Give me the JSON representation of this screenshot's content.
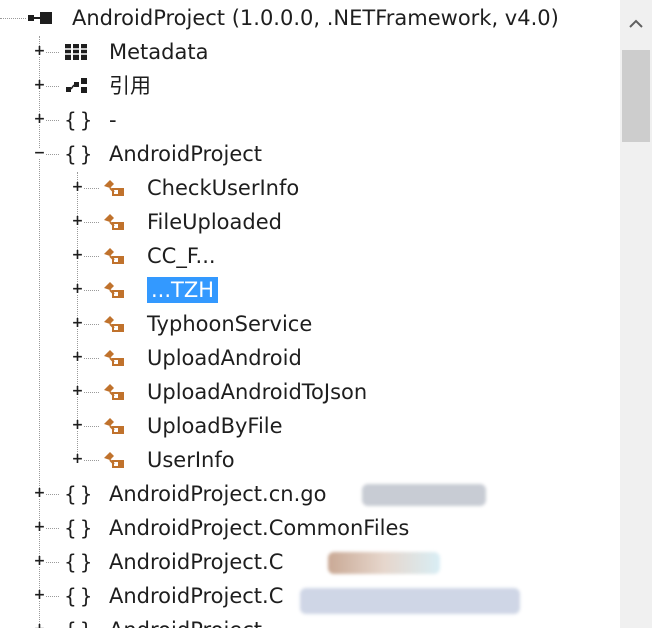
{
  "tree": {
    "root": {
      "label": "AndroidProject (1.0.0.0, .NETFramework, v4.0)"
    },
    "items": [
      {
        "label": "Metadata",
        "expander": "+",
        "icon": "metadata-icon"
      },
      {
        "label": "引用",
        "expander": "+",
        "icon": "references-icon"
      },
      {
        "label": "-",
        "expander": "+",
        "icon": "namespace-icon"
      },
      {
        "label": "AndroidProject",
        "expander": "−",
        "icon": "namespace-icon",
        "children": [
          {
            "label": "CheckUserInfo",
            "expander": "+",
            "icon": "class-icon"
          },
          {
            "label": "FileUploaded",
            "expander": "+",
            "icon": "class-icon"
          },
          {
            "label": "CC_F...",
            "expander": "+",
            "icon": "class-icon"
          },
          {
            "label": "...TZH",
            "expander": "+",
            "icon": "class-icon"
          },
          {
            "label": "TyphoonService",
            "expander": "+",
            "icon": "class-icon"
          },
          {
            "label": "UploadAndroid",
            "expander": "+",
            "icon": "class-icon"
          },
          {
            "label": "UploadAndroidToJson",
            "expander": "+",
            "icon": "class-icon"
          },
          {
            "label": "UploadByFile",
            "expander": "+",
            "icon": "class-icon"
          },
          {
            "label": "UserInfo",
            "expander": "+",
            "icon": "class-icon"
          }
        ]
      },
      {
        "label": "AndroidProject.cn.go",
        "expander": "+",
        "icon": "namespace-icon"
      },
      {
        "label": "AndroidProject.CommonFiles",
        "expander": "+",
        "icon": "namespace-icon"
      },
      {
        "label": "AndroidProject.C",
        "expander": "+",
        "icon": "namespace-icon"
      },
      {
        "label": "AndroidProject.C",
        "expander": "+",
        "icon": "namespace-icon"
      },
      {
        "label": "AndroidProject",
        "expander": "+",
        "icon": "namespace-icon"
      }
    ]
  },
  "colors": {
    "class_icon": "#c0722c",
    "selection": "#3399ff",
    "scrollbar_thumb": "#cdcdcd"
  }
}
